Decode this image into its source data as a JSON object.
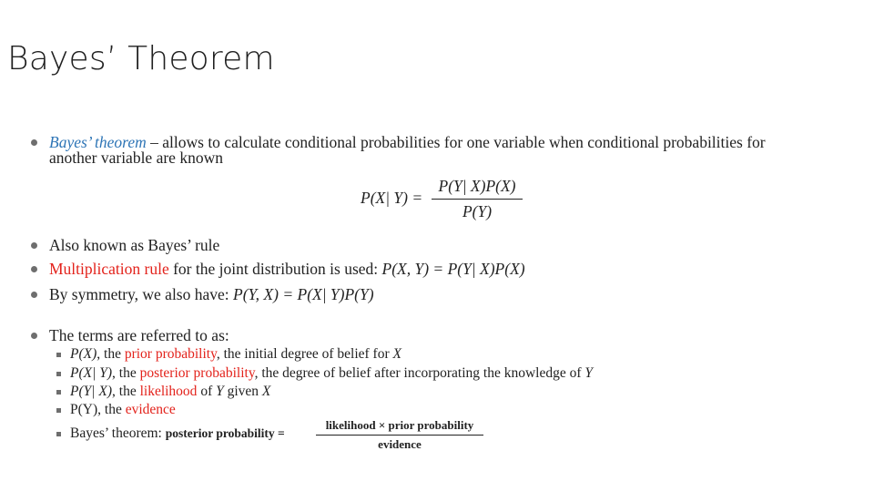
{
  "title": "Bayes’ Theorem",
  "b1": {
    "term": "Bayes’ theorem",
    "rest1": " – allows to calculate conditional probabilities for one variable when conditional probabilities for",
    "rest2": "another variable are known"
  },
  "formula": {
    "lhs": "P(X| Y) =",
    "num": "P(Y| X)P(X)",
    "den": "P(Y)"
  },
  "b2": {
    "text": "Also known as Bayes’ rule"
  },
  "b3": {
    "term": "Multiplication rule",
    "text": " for the joint distribution is used: ",
    "math": "P(X, Y) = P(Y| X)P(X)"
  },
  "b4": {
    "text": "By symmetry, we also have: ",
    "math": "P(Y, X) = P(X| Y)P(Y)"
  },
  "b5": {
    "text": "The terms are referred to as:"
  },
  "s1": {
    "math": "P(X)",
    "a": ", the ",
    "term": "prior probability",
    "b": ", the initial degree of belief for ",
    "math2": "X"
  },
  "s2": {
    "math": "P(X| Y)",
    "a": ", the ",
    "term": "posterior probability",
    "b": ", the degree of belief after incorporating the knowledge of ",
    "math2": "Y"
  },
  "s3": {
    "math": "P(Y| X)",
    "a": ", the ",
    "term": "likelihood",
    "b": " of ",
    "math2": "Y",
    "c": " given ",
    "math3": "X"
  },
  "s4": {
    "text": "P(Y), the ",
    "term": "evidence"
  },
  "s5": {
    "text": "Bayes’ theorem: ",
    "lhs": "posterior probability =",
    "num": "likelihood × prior probability",
    "den": "evidence"
  },
  "colors": {
    "blue": "#2e75b6",
    "red": "#e3221b",
    "text": "#222222"
  }
}
